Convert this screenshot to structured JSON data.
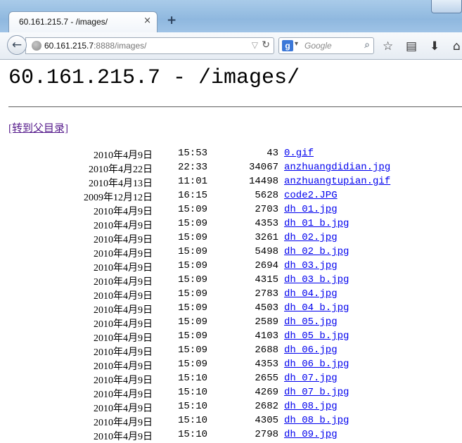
{
  "browser": {
    "tab_title": "60.161.215.7 - /images/",
    "tab_close": "×",
    "new_tab": "+",
    "url_host": "60.161.215.7",
    "url_rest": ":8888/images/",
    "search_engine_letter": "g",
    "search_placeholder": "Google",
    "icons": [
      "back-arrow-icon",
      "globe-icon",
      "bookmark-star-icon",
      "reload-icon",
      "google-icon",
      "search-icon",
      "star-icon",
      "bookmarks-list-icon",
      "download-icon",
      "home-icon"
    ]
  },
  "page": {
    "title": "60.161.215.7 - /images/",
    "parent_link": "[转到父目录]",
    "files": [
      {
        "date": "2010年4月9日",
        "time": "15:53",
        "size": "43",
        "name": "0.gif"
      },
      {
        "date": "2010年4月22日",
        "time": "22:33",
        "size": "34067",
        "name": "anzhuangdidian.jpg"
      },
      {
        "date": "2010年4月13日",
        "time": "11:01",
        "size": "14498",
        "name": "anzhuangtupian.gif"
      },
      {
        "date": "2009年12月12日",
        "time": "16:15",
        "size": "5628",
        "name": "code2.JPG"
      },
      {
        "date": "2010年4月9日",
        "time": "15:09",
        "size": "2703",
        "name": "dh_01.jpg"
      },
      {
        "date": "2010年4月9日",
        "time": "15:09",
        "size": "4353",
        "name": "dh_01_b.jpg"
      },
      {
        "date": "2010年4月9日",
        "time": "15:09",
        "size": "3261",
        "name": "dh_02.jpg"
      },
      {
        "date": "2010年4月9日",
        "time": "15:09",
        "size": "5498",
        "name": "dh_02_b.jpg"
      },
      {
        "date": "2010年4月9日",
        "time": "15:09",
        "size": "2694",
        "name": "dh_03.jpg"
      },
      {
        "date": "2010年4月9日",
        "time": "15:09",
        "size": "4315",
        "name": "dh_03_b.jpg"
      },
      {
        "date": "2010年4月9日",
        "time": "15:09",
        "size": "2783",
        "name": "dh_04.jpg"
      },
      {
        "date": "2010年4月9日",
        "time": "15:09",
        "size": "4503",
        "name": "dh_04_b.jpg"
      },
      {
        "date": "2010年4月9日",
        "time": "15:09",
        "size": "2589",
        "name": "dh_05.jpg"
      },
      {
        "date": "2010年4月9日",
        "time": "15:09",
        "size": "4103",
        "name": "dh_05_b.jpg"
      },
      {
        "date": "2010年4月9日",
        "time": "15:09",
        "size": "2688",
        "name": "dh_06.jpg"
      },
      {
        "date": "2010年4月9日",
        "time": "15:09",
        "size": "4353",
        "name": "dh_06_b.jpg"
      },
      {
        "date": "2010年4月9日",
        "time": "15:10",
        "size": "2655",
        "name": "dh_07.jpg"
      },
      {
        "date": "2010年4月9日",
        "time": "15:10",
        "size": "4269",
        "name": "dh_07_b.jpg"
      },
      {
        "date": "2010年4月9日",
        "time": "15:10",
        "size": "2682",
        "name": "dh_08.jpg"
      },
      {
        "date": "2010年4月9日",
        "time": "15:10",
        "size": "4305",
        "name": "dh_08_b.jpg"
      },
      {
        "date": "2010年4月9日",
        "time": "15:10",
        "size": "2798",
        "name": "dh_09.jpg"
      }
    ]
  }
}
